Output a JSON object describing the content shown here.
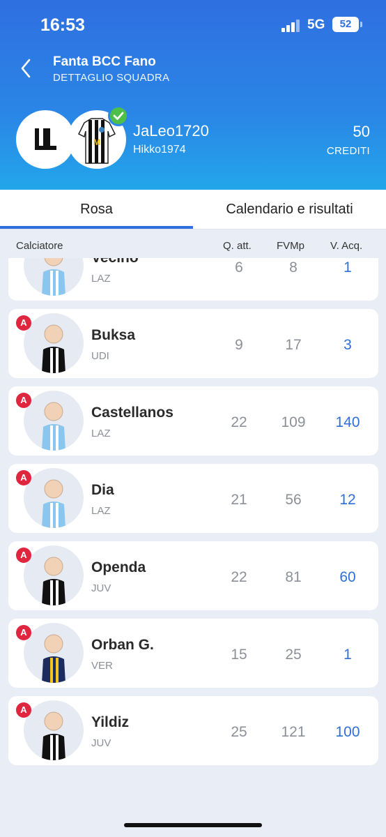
{
  "status": {
    "time": "16:53",
    "network": "5G",
    "battery": "52"
  },
  "header": {
    "title": "Fanta BCC Fano",
    "subtitle": "DETTAGLIO SQUADRA"
  },
  "team": {
    "name": "JaLeo1720",
    "owner": "Hikko1974",
    "credits": "50",
    "credits_label": "CREDITI"
  },
  "tabs": [
    {
      "label": "Rosa",
      "active": true
    },
    {
      "label": "Calendario e risultati",
      "active": false
    }
  ],
  "columns": {
    "player": "Calciatore",
    "quote": "Q. att.",
    "fvm": "FVMp",
    "value": "V. Acq."
  },
  "players": [
    {
      "name": "Vecino",
      "team": "LAZ",
      "role": "",
      "q": "6",
      "fvm": "8",
      "v": "1",
      "kit": "laz"
    },
    {
      "name": "Buksa",
      "team": "UDI",
      "role": "A",
      "q": "9",
      "fvm": "17",
      "v": "3",
      "kit": "udi"
    },
    {
      "name": "Castellanos",
      "team": "LAZ",
      "role": "A",
      "q": "22",
      "fvm": "109",
      "v": "140",
      "kit": "laz"
    },
    {
      "name": "Dia",
      "team": "LAZ",
      "role": "A",
      "q": "21",
      "fvm": "56",
      "v": "12",
      "kit": "laz"
    },
    {
      "name": "Openda",
      "team": "JUV",
      "role": "A",
      "q": "22",
      "fvm": "81",
      "v": "60",
      "kit": "juv"
    },
    {
      "name": "Orban G.",
      "team": "VER",
      "role": "A",
      "q": "15",
      "fvm": "25",
      "v": "1",
      "kit": "ver"
    },
    {
      "name": "Yildiz",
      "team": "JUV",
      "role": "A",
      "q": "25",
      "fvm": "121",
      "v": "100",
      "kit": "juv"
    }
  ],
  "colors": {
    "header_top": "#2f6fe0",
    "header_bottom": "#23a6ea",
    "accent": "#2e6fd8",
    "role_badge": "#e0253f",
    "check": "#4ec04a",
    "background": "#e9eef6"
  }
}
